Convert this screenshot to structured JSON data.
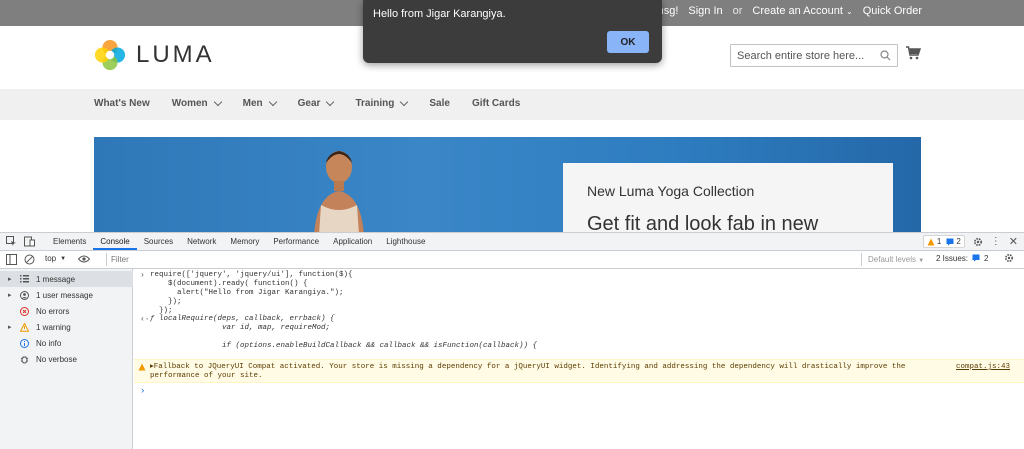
{
  "topbar": {
    "welcome": "come msg!",
    "sign_in": "Sign In",
    "or": "or",
    "create_account": "Create an Account",
    "quick_order": "Quick Order"
  },
  "header": {
    "logo_text": "LUMA",
    "search_placeholder": "Search entire store here..."
  },
  "nav": {
    "items": [
      {
        "label": "What's New",
        "dropdown": false
      },
      {
        "label": "Women",
        "dropdown": true
      },
      {
        "label": "Men",
        "dropdown": true
      },
      {
        "label": "Gear",
        "dropdown": true
      },
      {
        "label": "Training",
        "dropdown": true
      },
      {
        "label": "Sale",
        "dropdown": false
      },
      {
        "label": "Gift Cards",
        "dropdown": false
      }
    ]
  },
  "hero": {
    "promo_title": "New Luma Yoga Collection",
    "promo_subtitle": "Get fit and look fab in new"
  },
  "alert": {
    "message": "Hello from Jigar Karangiya.",
    "ok_label": "OK"
  },
  "devtools": {
    "tabs": [
      "Elements",
      "Console",
      "Sources",
      "Network",
      "Memory",
      "Performance",
      "Application",
      "Lighthouse"
    ],
    "active_tab": "Console",
    "warnings_count": "1",
    "messages_count": "2",
    "context": "top",
    "filter_placeholder": "Filter",
    "levels_label": "Default levels",
    "issues_label": "2 Issues:",
    "issues_count": "2",
    "sidebar": [
      {
        "label": "1 message",
        "icon": "list-icon",
        "expand": true,
        "selected": true
      },
      {
        "label": "1 user message",
        "icon": "user-icon",
        "expand": true,
        "selected": false
      },
      {
        "label": "No errors",
        "icon": "error-icon",
        "expand": false,
        "selected": false
      },
      {
        "label": "1 warning",
        "icon": "warning-icon",
        "expand": true,
        "selected": false
      },
      {
        "label": "No info",
        "icon": "info-icon",
        "expand": false,
        "selected": false
      },
      {
        "label": "No verbose",
        "icon": "bug-icon",
        "expand": false,
        "selected": false
      }
    ],
    "console": {
      "input_lines": [
        "require(['jquery', 'jquery/ui'], function($){",
        "    $(document).ready( function() {",
        "      alert(\"Hello from Jigar Karangiya.\");",
        "    });",
        "  });"
      ],
      "output_lines": [
        "ƒ localRequire(deps, callback, errback) {",
        "                var id, map, requireMod;",
        "",
        "                if (options.enableBuildCallback && callback && isFunction(callback)) {"
      ],
      "warning_text": "Fallback to JQueryUI Compat activated. Your store is missing a dependency for a jQueryUI widget. Identifying and addressing the dependency will drastically improve the performance of your site.",
      "warning_source": "compat.js:43"
    }
  }
}
